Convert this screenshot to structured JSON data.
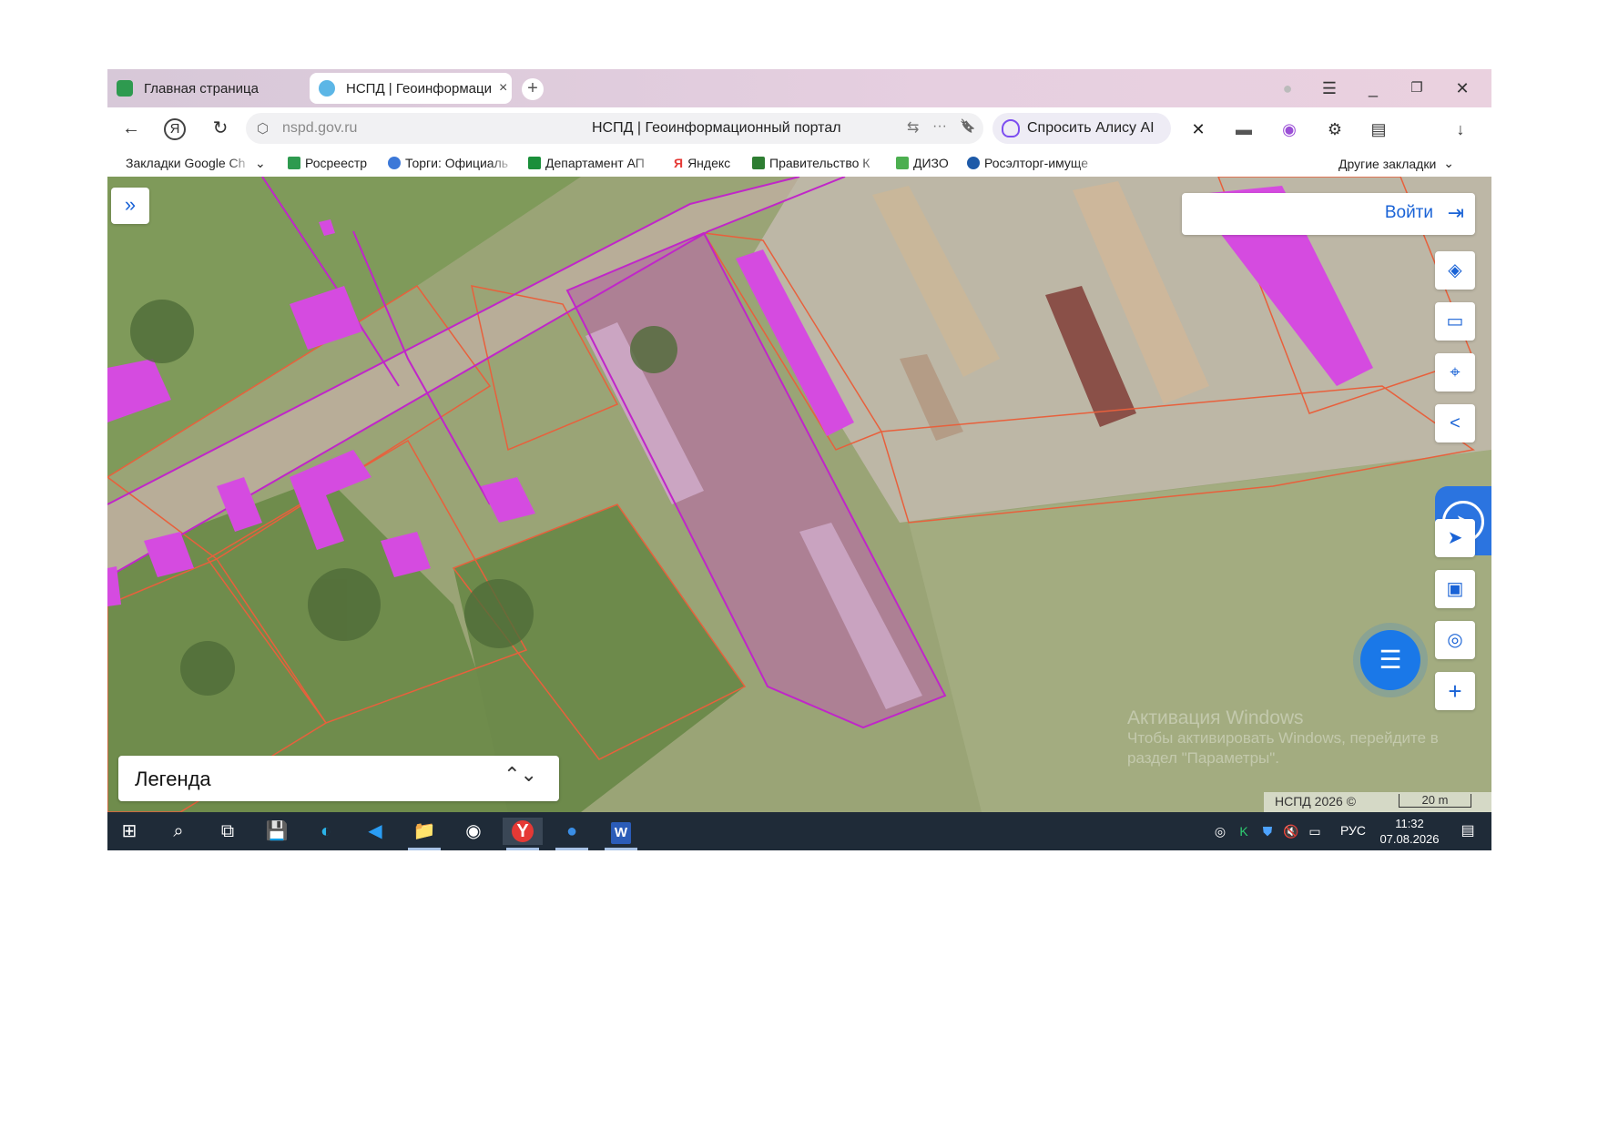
{
  "browser": {
    "tabs": [
      {
        "label": "Главная страница",
        "active": false
      },
      {
        "label": "НСПД | Геоинформаци",
        "active": true
      }
    ],
    "new_tab_glyph": "+",
    "close_glyph": "×",
    "window_controls": {
      "profile": "●",
      "menu": "☰",
      "minimize": "_",
      "restore": "❐",
      "close": "✕"
    },
    "nav": {
      "back": "←",
      "yandex": "Я",
      "reload": "↻",
      "download": "↓"
    },
    "address": {
      "url": "nspd.gov.ru",
      "page_title": "НСПД | Геоинформационный портал",
      "shield": "⬡",
      "translate": "⇆",
      "more": "···",
      "bookmark": "🔖"
    },
    "alice_label": "Спросить Алису AI",
    "bookmarks": [
      {
        "label": "Закладки Google Ch",
        "color": "#ffffff"
      },
      {
        "label": "Росреестр",
        "color": "#2e9a4f"
      },
      {
        "label": "Торги: Официаль",
        "color": "#3c78d8"
      },
      {
        "label": "Департамент АП",
        "color": "#1a8f3a"
      },
      {
        "label": "Яндекс",
        "color": "#e53935"
      },
      {
        "label": "Правительство К",
        "color": "#2e7d32"
      },
      {
        "label": "ДИЗО",
        "color": "#4caf50"
      },
      {
        "label": "Росэлторг-имуще",
        "color": "#1e5aa8"
      }
    ],
    "other_bookmarks": "Другие закладки",
    "bookmark_chevron": "⌄"
  },
  "map": {
    "expand_glyph": "»",
    "login": {
      "label": "Войти",
      "icon": "⇥"
    },
    "tools": [
      {
        "name": "layers-icon",
        "glyph": "◈"
      },
      {
        "name": "ruler-icon",
        "glyph": "▭"
      },
      {
        "name": "select-area-icon",
        "glyph": "⌖"
      },
      {
        "name": "share-icon",
        "glyph": "<"
      },
      {
        "name": "navigate-icon",
        "glyph": "➤"
      },
      {
        "name": "picture-in-picture-icon",
        "glyph": "▣"
      },
      {
        "name": "locate-icon",
        "glyph": "◎"
      },
      {
        "name": "zoom-in-icon",
        "glyph": "+"
      }
    ],
    "chat_glyph": "☰",
    "gosuslugi_glyph": "➤",
    "legend": {
      "label": "Легенда",
      "chevron": "⌃⌄"
    },
    "watermark": {
      "title": "Активация Windows",
      "line1": "Чтобы активировать Windows, перейдите в",
      "line2": "раздел \"Параметры\"."
    },
    "copyright": "НСПД 2026 ©",
    "scale": "20 m"
  },
  "taskbar": {
    "apps": [
      {
        "name": "start-icon",
        "glyph": "⊞"
      },
      {
        "name": "search-icon",
        "glyph": "⌕"
      },
      {
        "name": "task-view-icon",
        "glyph": "⧉"
      },
      {
        "name": "save-icon",
        "glyph": "💾"
      },
      {
        "name": "edge-icon",
        "glyph": "◐"
      },
      {
        "name": "app-icon",
        "glyph": "◀"
      },
      {
        "name": "explorer-icon",
        "glyph": "📁"
      },
      {
        "name": "app2-icon",
        "glyph": "◉"
      },
      {
        "name": "yandex-browser-icon",
        "glyph": "Y"
      },
      {
        "name": "app3-icon",
        "glyph": "●"
      },
      {
        "name": "word-icon",
        "glyph": "W"
      }
    ],
    "tray": [
      {
        "name": "tray-app-icon",
        "glyph": "◎"
      },
      {
        "name": "kaspersky-icon",
        "glyph": "K"
      },
      {
        "name": "shield-icon",
        "glyph": "⛊"
      },
      {
        "name": "volume-muted-icon",
        "glyph": "🔇"
      },
      {
        "name": "network-icon",
        "glyph": "▭"
      }
    ],
    "language": "РУС",
    "time": "11:32",
    "date": "07.08.2026",
    "notifications_glyph": "▤"
  },
  "colors": {
    "accent": "#1a63d6",
    "parcel_outline": "#e8603c",
    "zone": "#c026c9",
    "building": "#d54be0"
  }
}
